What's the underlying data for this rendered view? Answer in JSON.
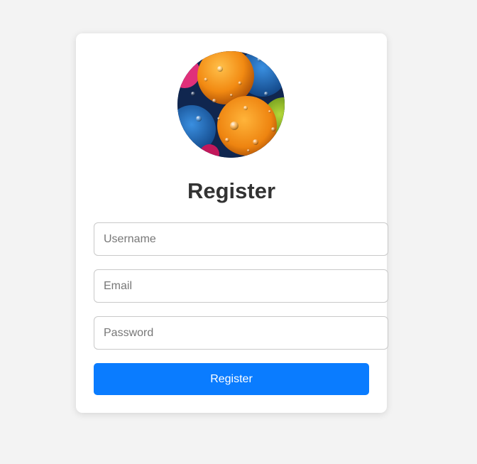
{
  "form": {
    "title": "Register",
    "username_placeholder": "Username",
    "email_placeholder": "Email",
    "password_placeholder": "Password",
    "submit_label": "Register"
  },
  "avatar": {
    "description_icon": "colorful-water-droplets-image"
  },
  "colors": {
    "page_background": "#f3f3f3",
    "card_background": "#ffffff",
    "accent": "#0a7cff",
    "title_text": "#333333",
    "input_border": "#c9c9c9"
  }
}
